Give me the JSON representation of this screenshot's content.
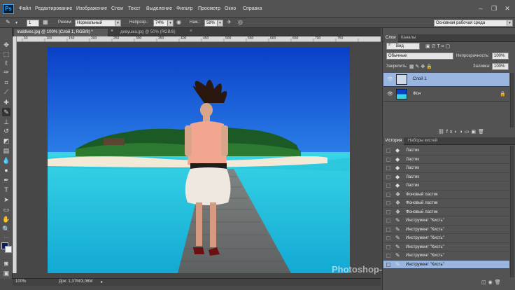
{
  "app": {
    "logo": "Ps"
  },
  "menu": [
    "Файл",
    "Редактирование",
    "Изображение",
    "Слои",
    "Текст",
    "Выделение",
    "Фильтр",
    "Просмотр",
    "Окно",
    "Справка"
  ],
  "window_controls": [
    "minimize-icon",
    "restore-icon",
    "close-icon"
  ],
  "options": {
    "brush_size": "1",
    "mode_label": "Режим:",
    "mode_value": "Нормальный",
    "opacity_label": "Непрозр.:",
    "opacity_value": "74%",
    "flow_label": "Наж.:",
    "flow_value": "58%",
    "workspace": "Основная рабочая среда"
  },
  "tabs": [
    {
      "label": "maldives.jpg @ 100% (Слой 1, RGB/8) *",
      "active": true
    },
    {
      "label": "девушка.jpg @ 50% (RGB/8)",
      "active": false
    }
  ],
  "ruler_marks": [
    "50",
    "100",
    "150",
    "200",
    "250",
    "300",
    "350",
    "400",
    "450",
    "500",
    "550",
    "600",
    "650",
    "700",
    "750"
  ],
  "status": {
    "zoom": "100%",
    "doc": "Док: 1,37M/3,06M"
  },
  "watermark": "Photoshop-help.ru | Сергей Иванов",
  "colors": {
    "foreground": "#0b1f5a",
    "background": "#f2f2f2",
    "selection": "#9ab6e0"
  },
  "layers_panel": {
    "tabs": [
      "Слои",
      "Каналы"
    ],
    "filter": "Вид",
    "blend_mode": "Обычные",
    "opacity_label": "Непрозрачность:",
    "opacity_value": "100%",
    "lock_label": "Закрепить:",
    "fill_label": "Заливка:",
    "fill_value": "100%",
    "layers": [
      {
        "name": "Слой 1",
        "selected": true
      },
      {
        "name": "Фон",
        "selected": false,
        "locked": true
      }
    ]
  },
  "history_panel": {
    "tabs": [
      "История",
      "Наборы кистей"
    ],
    "items": [
      {
        "label": "Ластик",
        "icon": "eraser-icon"
      },
      {
        "label": "Ластик",
        "icon": "eraser-icon"
      },
      {
        "label": "Ластик",
        "icon": "eraser-icon"
      },
      {
        "label": "Ластик",
        "icon": "eraser-icon"
      },
      {
        "label": "Ластик",
        "icon": "eraser-icon"
      },
      {
        "label": "Фоновый ластик",
        "icon": "background-eraser-icon"
      },
      {
        "label": "Фоновый ластик",
        "icon": "background-eraser-icon"
      },
      {
        "label": "Фоновый ластик",
        "icon": "background-eraser-icon"
      },
      {
        "label": "Инструмент \"Кисть\"",
        "icon": "brush-icon"
      },
      {
        "label": "Инструмент \"Кисть\"",
        "icon": "brush-icon"
      },
      {
        "label": "Инструмент \"Кисть\"",
        "icon": "brush-icon"
      },
      {
        "label": "Инструмент \"Кисть\"",
        "icon": "brush-icon"
      },
      {
        "label": "Инструмент \"Кисть\"",
        "icon": "brush-icon"
      },
      {
        "label": "Инструмент \"Кисть\"",
        "icon": "brush-icon"
      }
    ]
  }
}
